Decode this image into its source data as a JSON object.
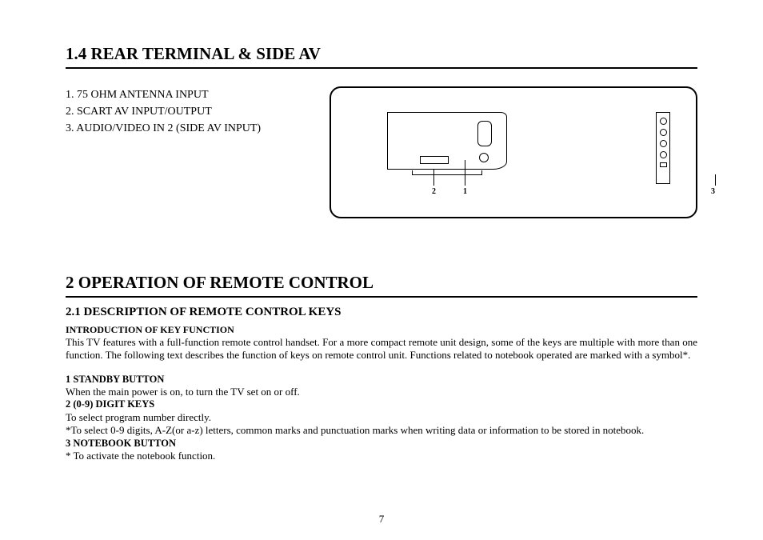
{
  "section1": {
    "heading": "1.4 REAR TERMINAL & SIDE AV",
    "terminals": [
      "1.  75 OHM ANTENNA INPUT",
      "2.  SCART AV INPUT/OUTPUT",
      "3.  AUDIO/VIDEO IN 2 (SIDE AV INPUT)"
    ],
    "diagram_labels": {
      "one": "1",
      "two": "2",
      "three": "3"
    }
  },
  "section2": {
    "heading": "2 OPERATION OF REMOTE CONTROL",
    "sub_heading": "2.1 DESCRIPTION OF REMOTE CONTROL KEYS",
    "intro_title": "INTRODUCTION OF KEY FUNCTION",
    "intro_body": "This TV features with a full-function remote control handset. For a more compact remote unit design, some of the keys are multiple with more than one function. The following text describes the function of keys on remote control unit. Functions related to notebook operated are marked with a symbol*.",
    "keys": [
      {
        "title": "1 STANDBY BUTTON",
        "lines": [
          "When the main power is on, to turn the TV set on or off."
        ]
      },
      {
        "title": "2 (0-9) DIGIT KEYS",
        "lines": [
          "To select program number directly.",
          "*To select 0-9 digits, A-Z(or a-z) letters, common marks and punctuation marks when writing data or information to be stored in notebook."
        ]
      },
      {
        "title": "3 NOTEBOOK BUTTON",
        "lines": [
          "* To activate the notebook function."
        ]
      }
    ]
  },
  "page_number": "7"
}
